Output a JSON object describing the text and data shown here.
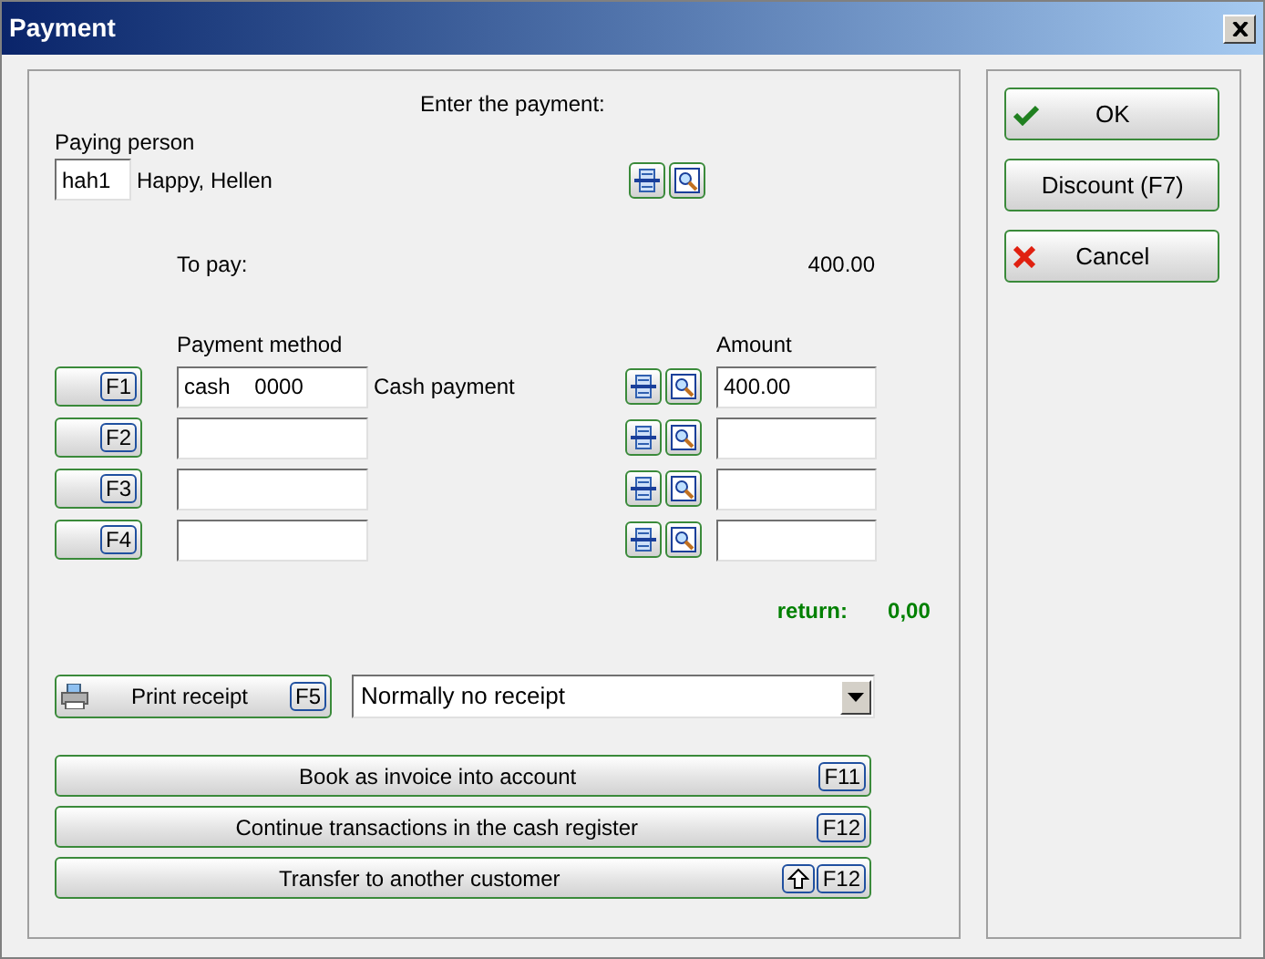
{
  "window": {
    "title": "Payment"
  },
  "header": "Enter the payment:",
  "paying_person": {
    "label": "Paying person",
    "code": "hah1",
    "name": "Happy, Hellen"
  },
  "to_pay": {
    "label": "To pay:",
    "value": "400.00"
  },
  "payments": {
    "method_header": "Payment method",
    "amount_header": "Amount",
    "rows": [
      {
        "key": "F1",
        "method": "cash    0000",
        "description": "Cash payment",
        "amount": "400.00"
      },
      {
        "key": "F2"
      },
      {
        "key": "F3"
      },
      {
        "key": "F4"
      }
    ]
  },
  "return": {
    "label": "return:",
    "value": "0,00"
  },
  "receipt": {
    "button": "Print receipt",
    "key": "F5",
    "option": "Normally no receipt"
  },
  "actions": [
    {
      "label": "Book as invoice into account",
      "shift": false,
      "key": "F11"
    },
    {
      "label": "Continue transactions in the cash register",
      "shift": false,
      "key": "F12"
    },
    {
      "label": "Transfer to another customer",
      "shift": true,
      "key": "F12"
    }
  ],
  "side_buttons": [
    {
      "label": "OK",
      "kind": "confirm"
    },
    {
      "label": "Discount (F7)",
      "kind": "plain"
    },
    {
      "label": "Cancel",
      "kind": "cancel"
    }
  ]
}
